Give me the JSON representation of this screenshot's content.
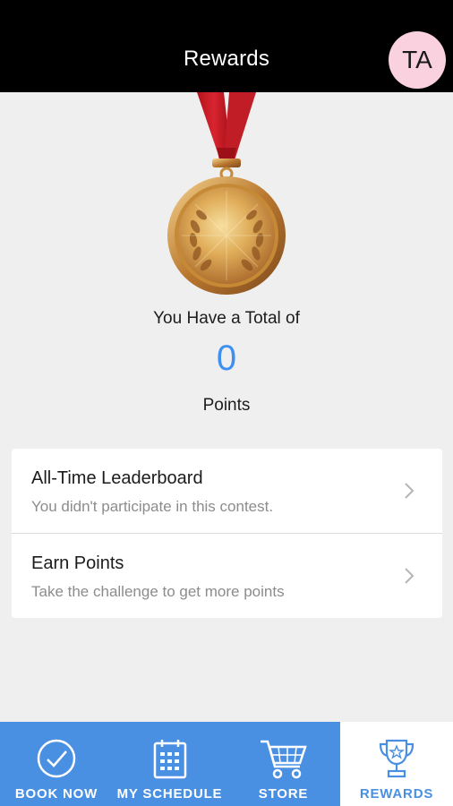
{
  "header": {
    "title": "Rewards",
    "avatar_initials": "TA",
    "background": "#000000",
    "avatar_color": "#f9d1df"
  },
  "summary": {
    "total_label": "You Have a Total of",
    "points_value": "0",
    "points_label": "Points",
    "points_color": "#3f8ff0",
    "medal_icon": "gold-medal-icon"
  },
  "rows": [
    {
      "title": "All-Time Leaderboard",
      "subtitle": "You didn't participate in this contest.",
      "icon": "chevron-right-icon"
    },
    {
      "title": "Earn Points",
      "subtitle": "Take the challenge to get more points",
      "icon": "chevron-right-icon"
    }
  ],
  "tabbar": {
    "accent": "#4a90e2",
    "tabs": [
      {
        "label": "BOOK NOW",
        "icon": "check-circle-icon",
        "active": false
      },
      {
        "label": "MY SCHEDULE",
        "icon": "calendar-icon",
        "active": false
      },
      {
        "label": "STORE",
        "icon": "cart-icon",
        "active": false
      },
      {
        "label": "REWARDS",
        "icon": "trophy-icon",
        "active": true
      }
    ]
  }
}
